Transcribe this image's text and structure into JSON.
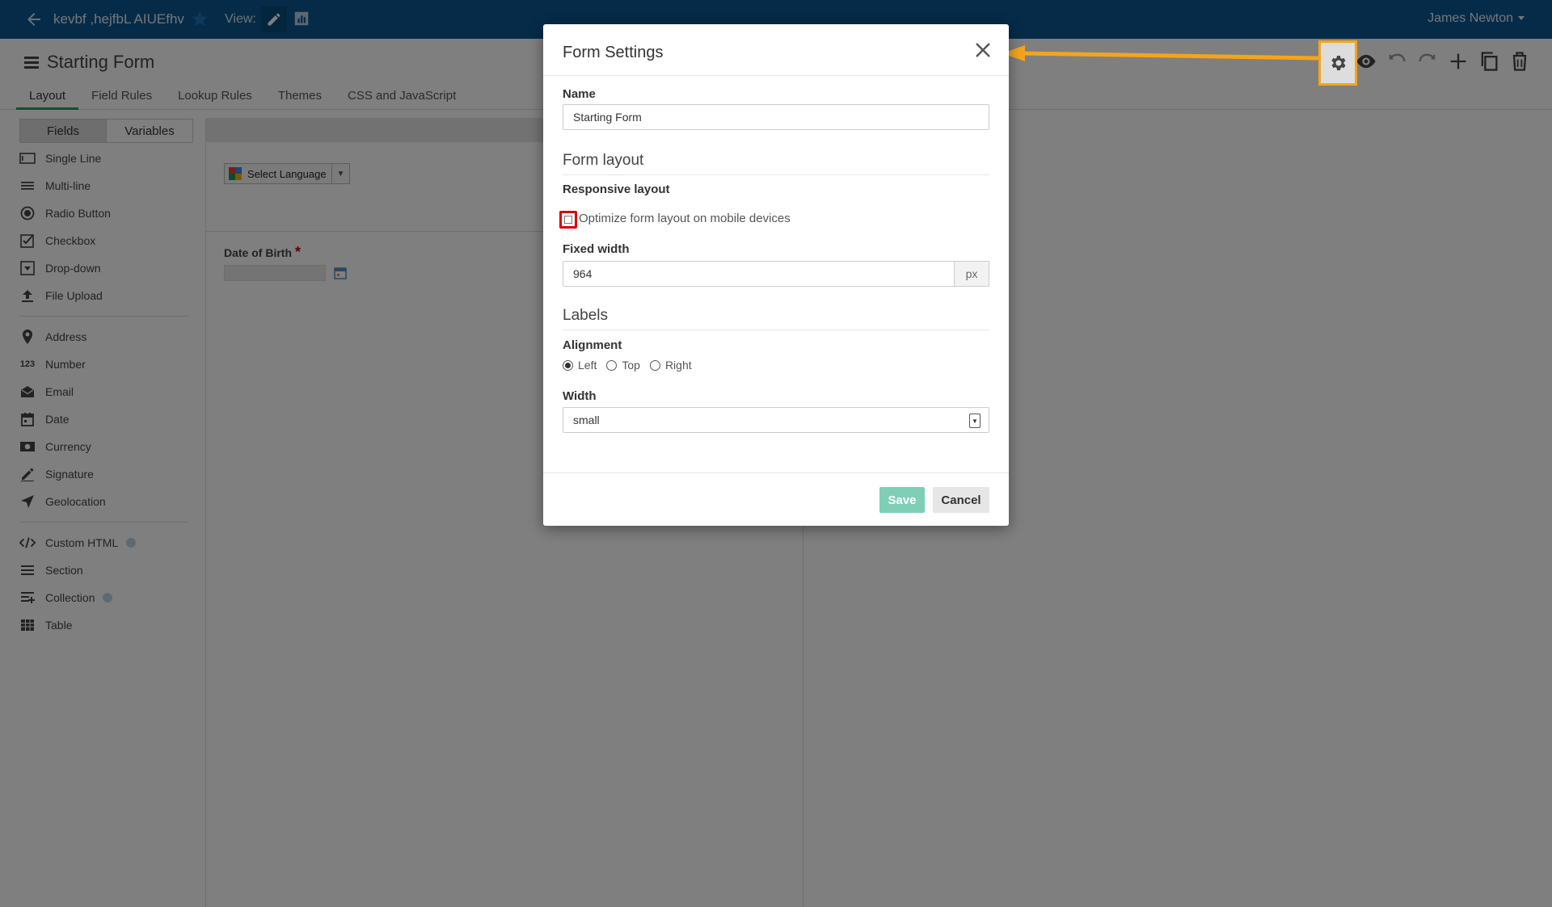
{
  "topbar": {
    "app_title": "kevbf ,hejfbL AIUEfhv",
    "view_label": "View:",
    "user_name": "James Newton"
  },
  "header": {
    "form_title": "Starting Form",
    "tabs": [
      {
        "label": "Layout",
        "active": true
      },
      {
        "label": "Field Rules"
      },
      {
        "label": "Lookup Rules"
      },
      {
        "label": "Themes"
      },
      {
        "label": "CSS and JavaScript"
      }
    ]
  },
  "left_panel": {
    "tabs": [
      "Fields",
      "Variables"
    ],
    "group1": [
      {
        "label": "Single Line",
        "icon": "single-line-icon"
      },
      {
        "label": "Multi-line",
        "icon": "multi-line-icon"
      },
      {
        "label": "Radio Button",
        "icon": "radio-button-icon"
      },
      {
        "label": "Checkbox",
        "icon": "checkbox-icon"
      },
      {
        "label": "Drop-down",
        "icon": "dropdown-icon"
      },
      {
        "label": "File Upload",
        "icon": "file-upload-icon"
      }
    ],
    "group2": [
      {
        "label": "Address",
        "icon": "map-pin-icon"
      },
      {
        "label": "Number",
        "icon": "number-icon"
      },
      {
        "label": "Email",
        "icon": "envelope-icon"
      },
      {
        "label": "Date",
        "icon": "calendar-icon"
      },
      {
        "label": "Currency",
        "icon": "currency-icon"
      },
      {
        "label": "Signature",
        "icon": "pen-icon"
      },
      {
        "label": "Geolocation",
        "icon": "location-arrow-icon"
      }
    ],
    "group3": [
      {
        "label": "Custom HTML",
        "icon": "code-icon",
        "help": true
      },
      {
        "label": "Section",
        "icon": "section-icon"
      },
      {
        "label": "Collection",
        "icon": "collection-icon",
        "help": true
      },
      {
        "label": "Table",
        "icon": "table-icon"
      }
    ]
  },
  "canvas": {
    "language_select": "Select Language",
    "dob_label": "Date of Birth",
    "dob_required": "*"
  },
  "modal": {
    "title": "Form Settings",
    "name_label": "Name",
    "name_value": "Starting Form",
    "form_layout_heading": "Form layout",
    "responsive_label": "Responsive layout",
    "optimize_label": "Optimize form layout on mobile devices",
    "optimize_checked": false,
    "fixed_width_label": "Fixed width",
    "fixed_width_value": "964",
    "fixed_width_unit": "px",
    "labels_heading": "Labels",
    "alignment_label": "Alignment",
    "alignment_options": [
      "Left",
      "Top",
      "Right"
    ],
    "alignment_selected": "Left",
    "width_label": "Width",
    "width_value": "small",
    "save_label": "Save",
    "cancel_label": "Cancel"
  },
  "colors": {
    "topbar": "#0a5690",
    "accent_tab": "#2a9d5c",
    "highlight": "#f4a51c",
    "checkbox_highlight": "#dd0000",
    "save_button": "#7fcfb7"
  }
}
